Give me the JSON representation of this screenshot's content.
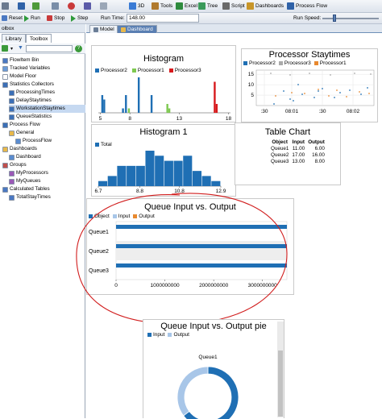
{
  "toolbar": {
    "top_items": [
      "3D",
      "Tools",
      "Excel",
      "Tree",
      "Script",
      "Dashboards",
      "Process Flow"
    ],
    "reset": "Reset",
    "run": "Run",
    "stop": "Stop",
    "step": "Step",
    "run_time_label": "Run Time:",
    "run_time_value": "148.00",
    "run_speed_label": "Run Speed:"
  },
  "left_panel": {
    "title": "olbox",
    "tabs": [
      "Library",
      "Toolbox"
    ],
    "tree": [
      {
        "label": "FlowItem Bin",
        "indent": 0,
        "color": "#4a78c2"
      },
      {
        "label": "Tracked Variables",
        "indent": 0,
        "color": "#6a9bd8"
      },
      {
        "label": "Model Floor",
        "indent": 0,
        "color": "#ffffff"
      },
      {
        "label": "Statistics Collectors",
        "indent": 0,
        "color": "#3b6fb6"
      },
      {
        "label": "ProcessingTimes",
        "indent": 1,
        "color": "#3b6fb6"
      },
      {
        "label": "DelayStaytimes",
        "indent": 1,
        "color": "#3b6fb6"
      },
      {
        "label": "WorkstationStaytimes",
        "indent": 1,
        "color": "#3b6fb6",
        "selected": true
      },
      {
        "label": "QueueStatistics",
        "indent": 1,
        "color": "#3b6fb6"
      },
      {
        "label": "Process Flow",
        "indent": 0,
        "color": "#3b6fb6"
      },
      {
        "label": "General",
        "indent": 1,
        "color": "#e8b84a"
      },
      {
        "label": "ProcessFlow",
        "indent": 2,
        "color": "#5a8ccf"
      },
      {
        "label": "Dashboards",
        "indent": 0,
        "color": "#e8b84a"
      },
      {
        "label": "Dashboard",
        "indent": 1,
        "color": "#5a8ccf"
      },
      {
        "label": "Groups",
        "indent": 0,
        "color": "#c0504d"
      },
      {
        "label": "MyProcessors",
        "indent": 1,
        "color": "#9b59b6"
      },
      {
        "label": "MyQueues",
        "indent": 1,
        "color": "#9b59b6"
      },
      {
        "label": "Calculated Tables",
        "indent": 0,
        "color": "#4a78c2"
      },
      {
        "label": "TotalStayTimes",
        "indent": 1,
        "color": "#4a78c2"
      }
    ]
  },
  "doc_tabs": [
    "Model",
    "Dashboard"
  ],
  "widgets": {
    "histogram": {
      "title": "Histogram",
      "legend": [
        "Processor2",
        "Processor1",
        "Processor3"
      ],
      "colors": [
        "#1f6fb4",
        "#7ec850",
        "#d7191c"
      ],
      "x_ticks": [
        "5",
        "8",
        "13",
        "18"
      ]
    },
    "staytimes": {
      "title": "Processor Staytimes",
      "legend": [
        "Processor2",
        "Processor3",
        "Processor1"
      ],
      "colors": [
        "#1f6fb4",
        "#aaaaaa",
        "#e8892f"
      ],
      "y_ticks": [
        "15",
        "10",
        "5"
      ],
      "x_ticks": [
        ":30",
        "08:01",
        ":30",
        "08:02"
      ]
    },
    "histogram1": {
      "title": "Histogram 1",
      "legend": [
        "Total"
      ],
      "x_ticks": [
        "6.7",
        "8.8",
        "10.8",
        "12.9"
      ]
    },
    "table_chart": {
      "title": "Table Chart",
      "headers": [
        "Object",
        "Input",
        "Output"
      ],
      "rows": [
        [
          "Queue1",
          "11.00",
          "6.00"
        ],
        [
          "Queue2",
          "17.00",
          "16.00"
        ],
        [
          "Queue3",
          "13.00",
          "8.00"
        ]
      ]
    },
    "queue_io": {
      "title": "Queue Input vs. Output",
      "legend": [
        "Object",
        "Input",
        "Output"
      ],
      "colors": [
        "#1f6fb4",
        "#a8c6e8",
        "#e8892f"
      ],
      "categories": [
        "Queue1",
        "Queue2",
        "Queue3"
      ],
      "x_ticks": [
        "0",
        "1000000000",
        "2000000000",
        "3000000000"
      ]
    },
    "queue_pie": {
      "title": "Queue Input vs. Output pie",
      "legend": [
        "Input",
        "Output"
      ],
      "colors": [
        "#1f6fb4",
        "#a8c6e8"
      ],
      "center_label": "Queue1"
    }
  },
  "chart_data": [
    {
      "type": "bar",
      "title": "Histogram",
      "series": [
        {
          "name": "Processor2",
          "x": [
            5.2,
            5.4,
            7.3,
            7.6,
            8.9,
            10.2
          ],
          "values": [
            4,
            3,
            1,
            4,
            8,
            4
          ]
        },
        {
          "name": "Processor1",
          "x": [
            7.9,
            11.8,
            12.0
          ],
          "values": [
            1,
            2,
            1
          ]
        },
        {
          "name": "Processor3",
          "x": [
            16.6,
            16.8
          ],
          "values": [
            7,
            2
          ]
        }
      ],
      "xlim": [
        4.8,
        18.2
      ]
    },
    {
      "type": "scatter",
      "title": "Processor Staytimes",
      "ylim": [
        0,
        17
      ]
    },
    {
      "type": "bar",
      "title": "Histogram 1",
      "series": [
        {
          "name": "Total",
          "values": [
            1,
            2,
            4,
            4,
            4,
            7,
            6,
            5,
            5,
            6,
            3,
            2,
            1
          ]
        }
      ],
      "xlim": [
        6.7,
        12.9
      ]
    },
    {
      "type": "table",
      "title": "Table Chart",
      "headers": [
        "Object",
        "Input",
        "Output"
      ],
      "rows": [
        [
          "Queue1",
          11,
          6
        ],
        [
          "Queue2",
          17,
          16
        ],
        [
          "Queue3",
          13,
          8
        ]
      ]
    },
    {
      "type": "bar",
      "title": "Queue Input vs. Output",
      "categories": [
        "Queue1",
        "Queue2",
        "Queue3"
      ],
      "series": [
        {
          "name": "Object",
          "values": [
            3500000000,
            3500000000,
            3500000000
          ]
        }
      ],
      "xlim": [
        0,
        3500000000
      ]
    },
    {
      "type": "pie",
      "title": "Queue Input vs. Output pie",
      "categories": [
        "Input",
        "Output"
      ],
      "values": [
        11,
        6
      ]
    }
  ]
}
